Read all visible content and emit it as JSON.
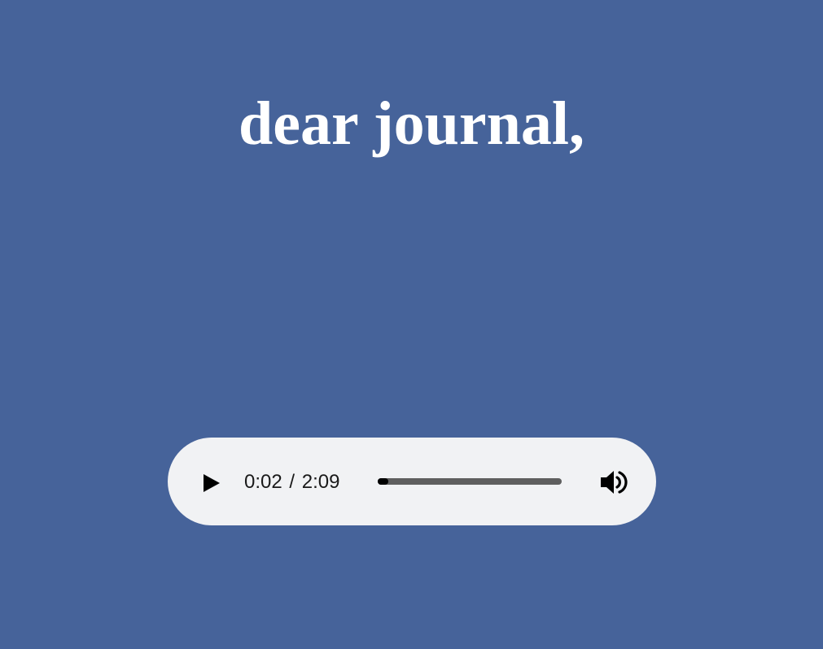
{
  "page": {
    "title": "dear journal,",
    "background_color": "#46639a",
    "text_color": "#ffffff"
  },
  "audio_player": {
    "current_time": "0:02",
    "separator": "/",
    "duration": "2:09",
    "progress_fraction": 0.0155,
    "background_color": "#f1f2f4",
    "track_color": "#5f5f5f",
    "fill_color": "#000000",
    "play_icon": "play-icon",
    "volume_icon": "volume-icon"
  }
}
